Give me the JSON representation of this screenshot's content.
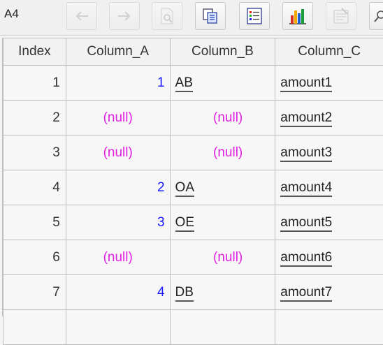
{
  "toolbar": {
    "cell_ref": "A4",
    "buttons": [
      {
        "icon": "back-arrow-icon",
        "enabled": false
      },
      {
        "icon": "forward-arrow-icon",
        "enabled": false
      },
      {
        "icon": "inspect-icon",
        "enabled": false
      },
      {
        "icon": "copy-icon",
        "enabled": true
      },
      {
        "icon": "list-icon",
        "enabled": true
      },
      {
        "icon": "bar-chart-icon",
        "enabled": true
      },
      {
        "icon": "properties-icon",
        "enabled": false
      },
      {
        "icon": "search-icon",
        "enabled": true
      }
    ]
  },
  "table": {
    "headers": [
      "Index",
      "Column_A",
      "Column_B",
      "Column_C"
    ],
    "rows": [
      {
        "index": "1",
        "a": "1",
        "b": "AB",
        "c": "amount1"
      },
      {
        "index": "2",
        "a": "(null)",
        "b": "(null)",
        "c": "amount2"
      },
      {
        "index": "3",
        "a": "(null)",
        "b": "(null)",
        "c": "amount3"
      },
      {
        "index": "4",
        "a": "2",
        "b": "OA",
        "c": "amount4"
      },
      {
        "index": "5",
        "a": "3",
        "b": "OE",
        "c": "amount5"
      },
      {
        "index": "6",
        "a": "(null)",
        "b": "(null)",
        "c": "amount6"
      },
      {
        "index": "7",
        "a": "4",
        "b": "DB",
        "c": "amount7"
      }
    ]
  },
  "colors": {
    "number": "#1a1aff",
    "null": "#e020e0",
    "grid_border": "#bdbdbd"
  }
}
